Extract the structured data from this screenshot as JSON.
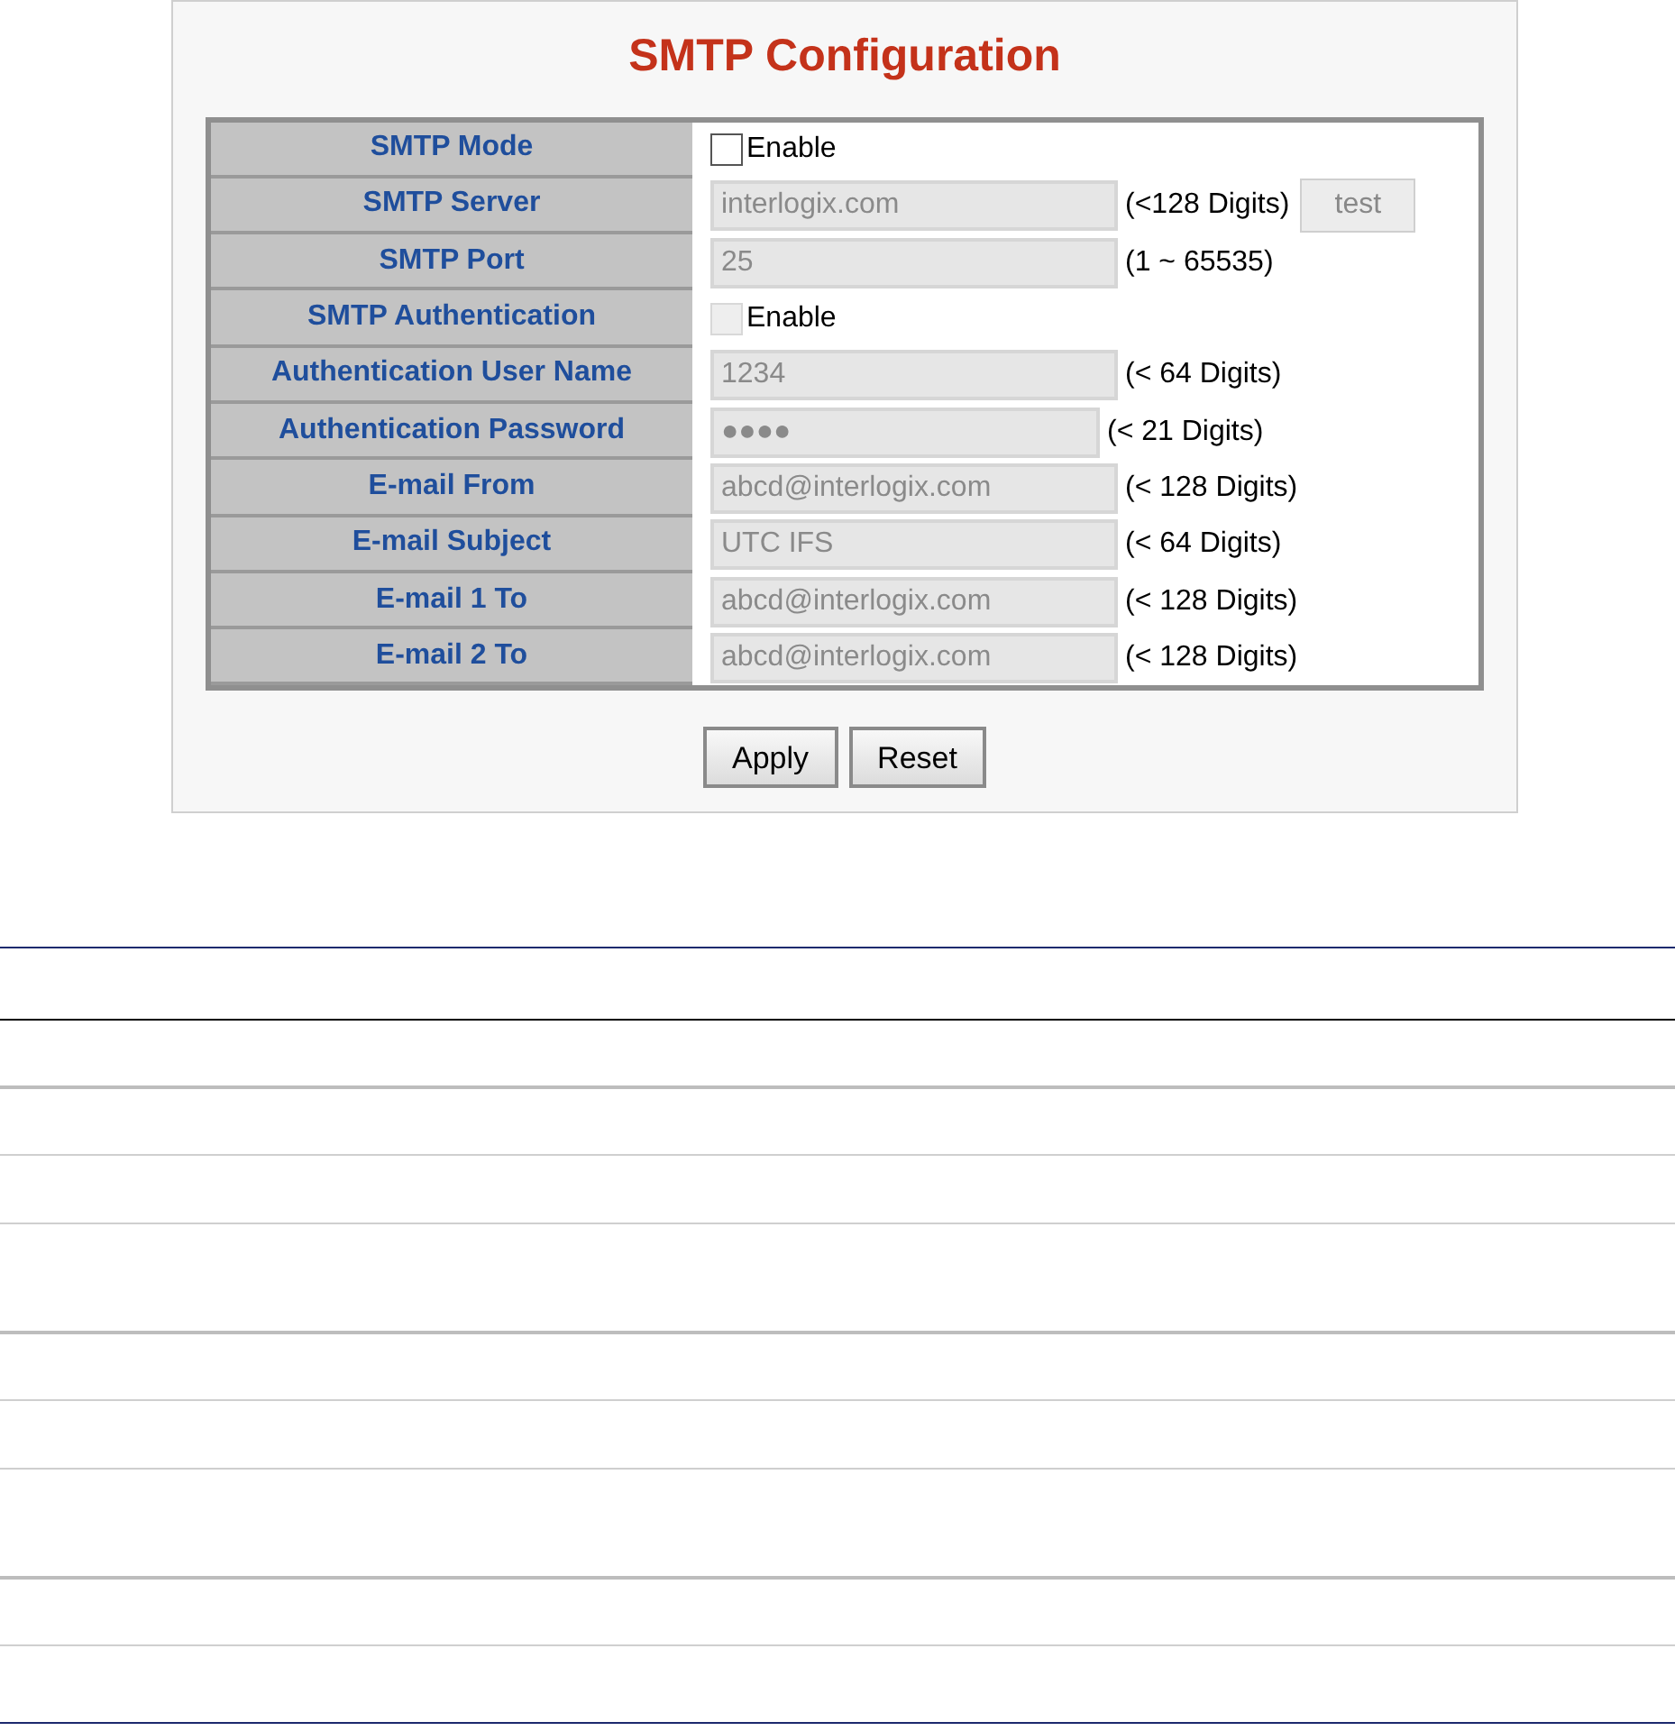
{
  "title": "SMTP Configuration",
  "rows": [
    {
      "label": "SMTP Mode",
      "kind": "checkbox",
      "checked": false,
      "disabled": false,
      "text": "Enable"
    },
    {
      "label": "SMTP Server",
      "kind": "input",
      "value": "interlogix.com",
      "disabled": true,
      "hint": "(<128 Digits)",
      "button": {
        "label": "test",
        "disabled": true
      }
    },
    {
      "label": "SMTP Port",
      "kind": "input",
      "value": "25",
      "disabled": true,
      "hint": "(1 ~ 65535)"
    },
    {
      "label": "SMTP Authentication",
      "kind": "checkbox",
      "checked": false,
      "disabled": true,
      "text": "Enable"
    },
    {
      "label": "Authentication User Name",
      "kind": "input",
      "value": "1234",
      "disabled": true,
      "hint": "(< 64 Digits)"
    },
    {
      "label": "Authentication Password",
      "kind": "password",
      "value": "●●●●",
      "disabled": true,
      "hint": "(< 21 Digits)"
    },
    {
      "label": "E-mail From",
      "kind": "input",
      "value": "abcd@interlogix.com",
      "disabled": true,
      "hint": "(< 128 Digits)"
    },
    {
      "label": "E-mail Subject",
      "kind": "input",
      "value": "UTC IFS",
      "disabled": true,
      "hint": "(< 64 Digits)"
    },
    {
      "label": "E-mail 1 To",
      "kind": "input",
      "value": "abcd@interlogix.com",
      "disabled": true,
      "hint": "(< 128 Digits)"
    },
    {
      "label": "E-mail 2 To",
      "kind": "input",
      "value": "abcd@interlogix.com",
      "disabled": true,
      "hint": "(< 128 Digits)"
    }
  ],
  "buttons": [
    "Apply",
    "Reset"
  ]
}
